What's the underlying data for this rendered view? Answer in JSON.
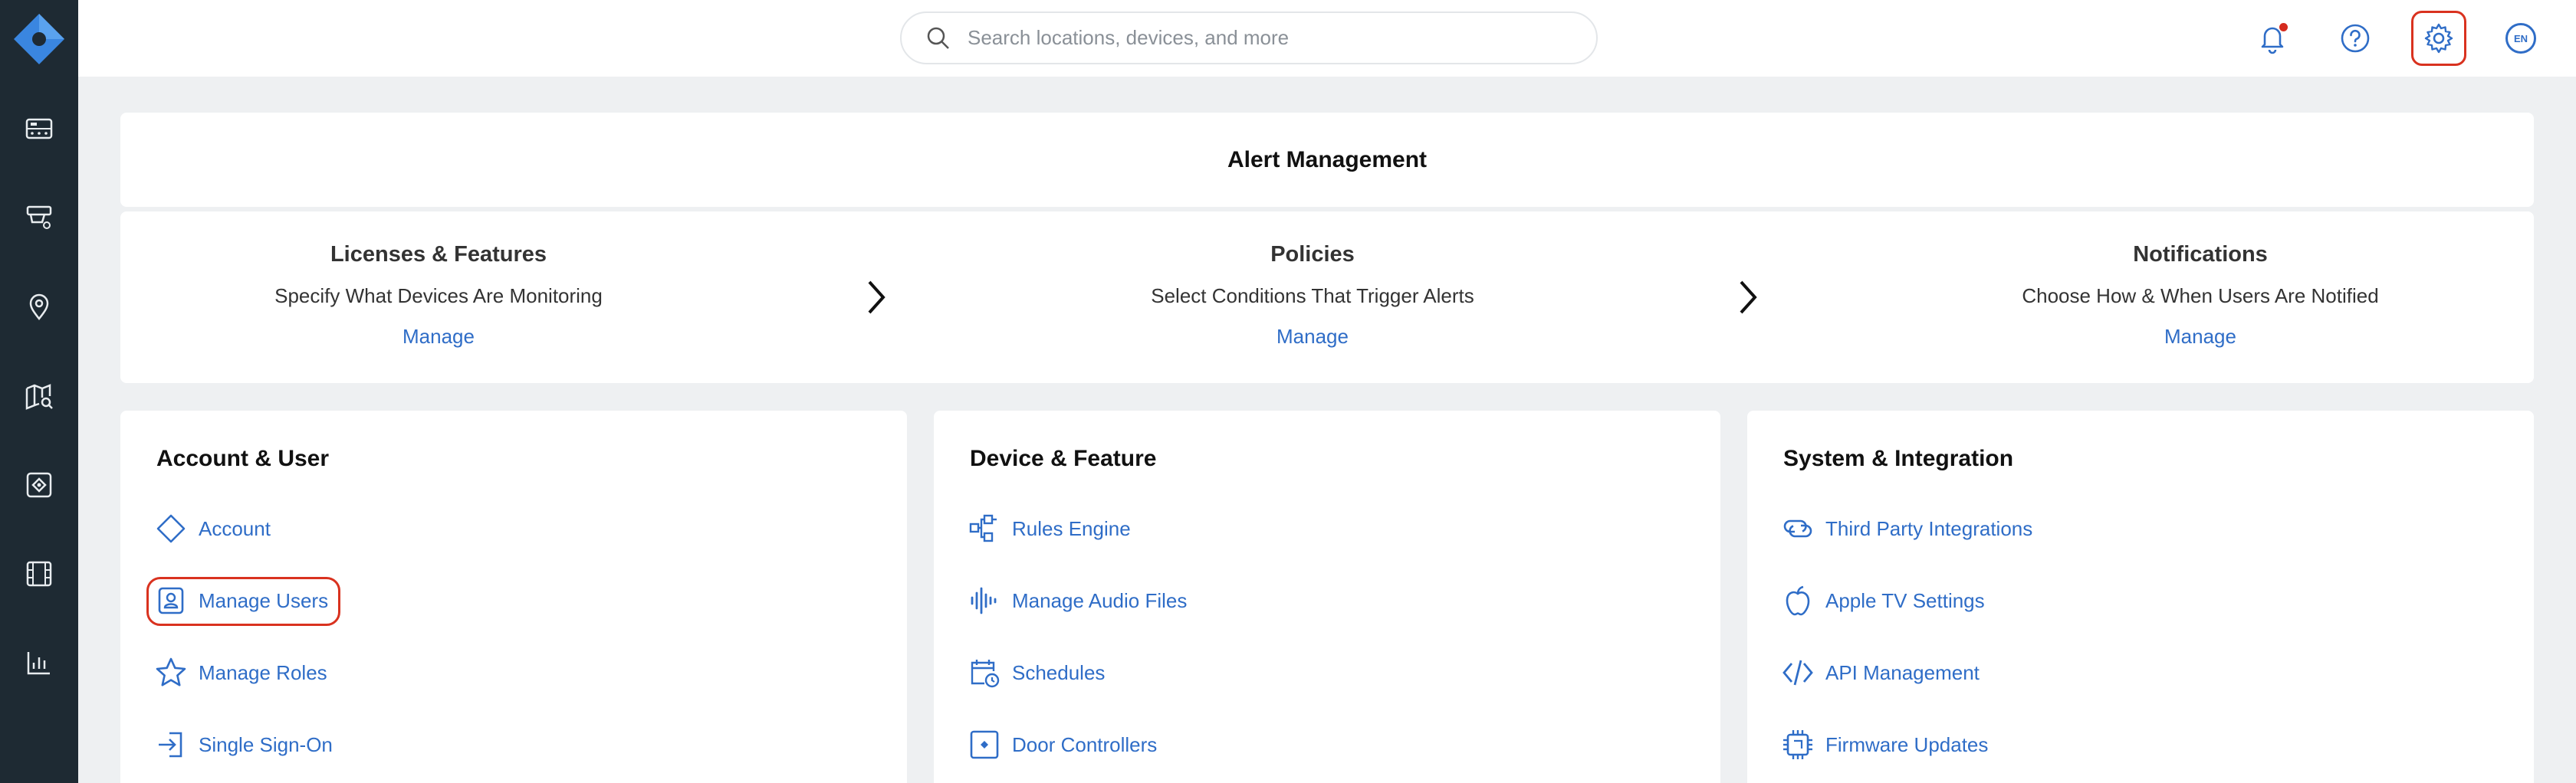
{
  "search": {
    "placeholder": "Search locations, devices, and more"
  },
  "topbar": {
    "language": "EN"
  },
  "sidebar": {
    "items": [
      "dashboard-icon",
      "camera-icon",
      "location-pin-icon",
      "map-search-icon",
      "access-control-icon",
      "video-reel-icon",
      "analytics-chart-icon"
    ]
  },
  "alert_management": {
    "title": "Alert Management",
    "steps": [
      {
        "title": "Licenses & Features",
        "description": "Specify What Devices Are Monitoring",
        "link": "Manage"
      },
      {
        "title": "Policies",
        "description": "Select Conditions That Trigger Alerts",
        "link": "Manage"
      },
      {
        "title": "Notifications",
        "description": "Choose How & When Users Are Notified",
        "link": "Manage"
      }
    ]
  },
  "sections": [
    {
      "title": "Account & User",
      "items": [
        {
          "label": "Account",
          "icon": "diamond-icon"
        },
        {
          "label": "Manage Users",
          "icon": "user-badge-icon"
        },
        {
          "label": "Manage Roles",
          "icon": "star-icon"
        },
        {
          "label": "Single Sign-On",
          "icon": "sign-in-icon"
        }
      ]
    },
    {
      "title": "Device & Feature",
      "items": [
        {
          "label": "Rules Engine",
          "icon": "rules-flow-icon"
        },
        {
          "label": "Manage Audio Files",
          "icon": "audio-wave-icon"
        },
        {
          "label": "Schedules",
          "icon": "calendar-clock-icon"
        },
        {
          "label": "Door Controllers",
          "icon": "door-controller-icon"
        }
      ]
    },
    {
      "title": "System & Integration",
      "items": [
        {
          "label": "Third Party Integrations",
          "icon": "link-chain-icon"
        },
        {
          "label": "Apple TV Settings",
          "icon": "apple-icon"
        },
        {
          "label": "API Management",
          "icon": "code-icon"
        },
        {
          "label": "Firmware Updates",
          "icon": "chip-icon"
        }
      ]
    }
  ],
  "colors": {
    "sidebar": "#1e2a33",
    "accent": "#2f6dc7",
    "highlight": "#d9321f",
    "logo": "#3a86e0"
  }
}
